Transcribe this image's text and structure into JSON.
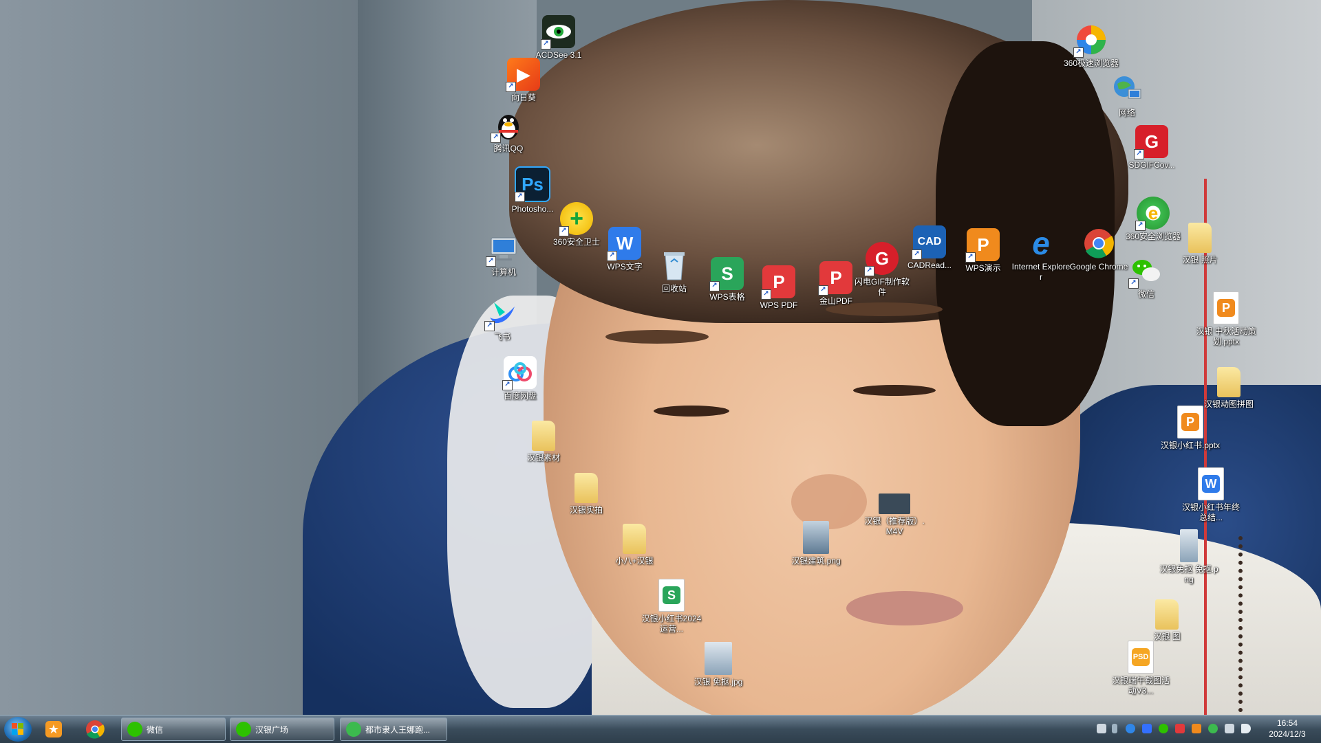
{
  "desktop": {
    "icons": [
      {
        "label": "ACDSee 3.1"
      },
      {
        "label": "向日葵"
      },
      {
        "label": "腾讯QQ"
      },
      {
        "label": "Photosho..."
      },
      {
        "label": "360安全卫士"
      },
      {
        "label": "计算机"
      },
      {
        "label": "WPS文字"
      },
      {
        "label": "回收站"
      },
      {
        "label": "WPS表格"
      },
      {
        "label": "WPS PDF"
      },
      {
        "label": "金山PDF"
      },
      {
        "label": "闪电GIF制作软件"
      },
      {
        "label": "CADRead..."
      },
      {
        "label": "WPS演示"
      },
      {
        "label": "Internet Explorer"
      },
      {
        "label": "Google Chrome"
      },
      {
        "label": "飞书"
      },
      {
        "label": "百度网盘"
      },
      {
        "label": "汉银素材"
      },
      {
        "label": "汉银实拍"
      },
      {
        "label": "小八+汉银"
      },
      {
        "label": "汉银小红书2024运营..."
      },
      {
        "label": "汉银 免抠.jpg"
      },
      {
        "label": "汉银建筑.png"
      },
      {
        "label": "汉银（推荐版）.M4V"
      },
      {
        "label": "360极速浏览器"
      },
      {
        "label": "网络"
      },
      {
        "label": "SDGIFCov..."
      },
      {
        "label": "360安全浏览器"
      },
      {
        "label": "微信"
      },
      {
        "label": "汉银 照片"
      },
      {
        "label": "汉银 中秋活动策划.pptx"
      },
      {
        "label": "汉银动图拼图"
      },
      {
        "label": "汉银小红书.pptx"
      },
      {
        "label": "汉银小红书年终总结..."
      },
      {
        "label": "汉银免抠 免抠.png"
      },
      {
        "label": "汉银 图"
      },
      {
        "label": "汉银端午截图活动V3..."
      }
    ],
    "icon_glyphs": {
      "ps": "Ps",
      "w": "W",
      "s": "S",
      "p": "P",
      "cad": "CAD",
      "e": "e",
      "psd": "PSD"
    }
  },
  "taskbar": {
    "pinned": [
      {
        "name": "start-menu-icon"
      },
      {
        "name": "favorites-icon"
      },
      {
        "name": "chrome-icon"
      }
    ],
    "windows": [
      {
        "label": "微信"
      },
      {
        "label": "汉银广场"
      },
      {
        "label": "都市隶人王娜跑..."
      }
    ],
    "clock": {
      "time": "16:54",
      "date": "2024/12/3"
    }
  },
  "colors": {
    "taskbar": "#3a4c5b",
    "wps_red": "#e2393b",
    "wps_green": "#2aa55a",
    "wps_blue": "#2f7bea",
    "wps_orange": "#f08a1d"
  }
}
